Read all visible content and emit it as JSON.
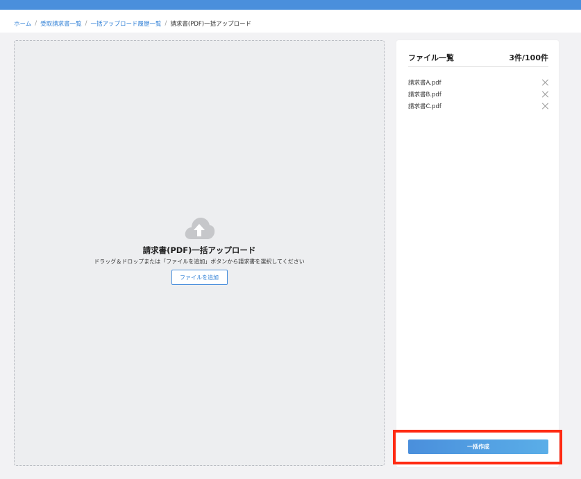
{
  "colors": {
    "topbar": "#4a8fdc",
    "link": "#2f7fd6",
    "highlight": "#ff2a12"
  },
  "breadcrumb": {
    "items": [
      "ホーム",
      "受取請求書一覧",
      "一括アップロード履歴一覧"
    ],
    "separator": "/",
    "current": "請求書(PDF)一括アップロード"
  },
  "dropzone": {
    "icon": "cloud-upload-icon",
    "title": "請求書(PDF)一括アップロード",
    "subtitle": "ドラッグ＆ドロップまたは「ファイルを追加」ボタンから請求書を選択してください",
    "add_button_label": "ファイルを追加"
  },
  "file_panel": {
    "title": "ファイル一覧",
    "count": "3件/100件",
    "files": [
      {
        "name": "請求書A.pdf",
        "remove_icon": "close-icon"
      },
      {
        "name": "請求書B.pdf",
        "remove_icon": "close-icon"
      },
      {
        "name": "請求書C.pdf",
        "remove_icon": "close-icon"
      }
    ]
  },
  "create_button_label": "一括作成"
}
